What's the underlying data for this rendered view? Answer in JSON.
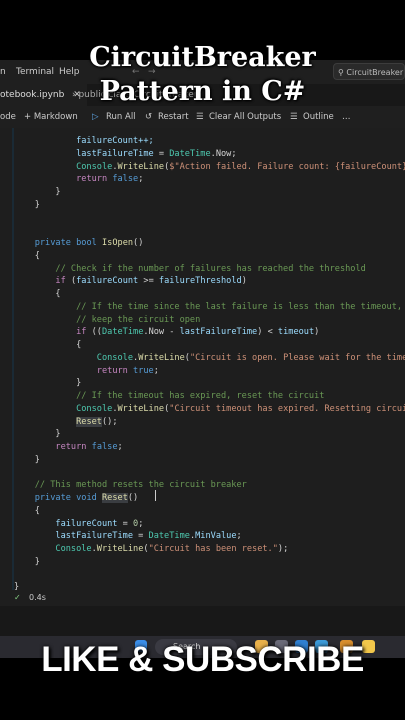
{
  "overlay": {
    "title_line1": "CircuitBreaker",
    "title_line2": "Pattern in C#",
    "cta": "LIKE & SUBSCRIBE"
  },
  "menubar": {
    "items": [
      "n",
      "Terminal",
      "Help"
    ],
    "search": "CircuitBreaker"
  },
  "tabbar": {
    "tab_label": "otebook.ipynb",
    "breadcrumb": "› public class CircuitBreaker"
  },
  "toolbar": {
    "items": [
      "ode",
      "+ Markdown",
      "Run All",
      "Restart",
      "Clear All Outputs",
      "Outline",
      "…"
    ]
  },
  "editor": {
    "lines": [
      [
        {
          "t": "            failureCount++;",
          "c": "var"
        }
      ],
      [
        {
          "t": "            lastFailureTime",
          "c": "var"
        },
        {
          "t": " = ",
          "c": "op"
        },
        {
          "t": "DateTime",
          "c": "ty"
        },
        {
          "t": ".Now;",
          "c": "op"
        }
      ],
      [
        {
          "t": "            Console",
          "c": "ty"
        },
        {
          "t": ".",
          "c": "op"
        },
        {
          "t": "WriteLine",
          "c": "fn"
        },
        {
          "t": "(",
          "c": "op"
        },
        {
          "t": "$\"Action failed. Failure count: {failureCount}\");",
          "c": "str"
        }
      ],
      [
        {
          "t": "            ",
          "c": "op"
        },
        {
          "t": "return",
          "c": "ctl"
        },
        {
          "t": " ",
          "c": "op"
        },
        {
          "t": "false",
          "c": "kw"
        },
        {
          "t": ";",
          "c": "op"
        }
      ],
      [
        {
          "t": "        }",
          "c": "op"
        }
      ],
      [
        {
          "t": "    }",
          "c": "op"
        }
      ],
      [
        {
          "t": "",
          "c": "op"
        }
      ],
      [
        {
          "t": "",
          "c": "op"
        }
      ],
      [
        {
          "t": "    ",
          "c": "op"
        },
        {
          "t": "private",
          "c": "kw"
        },
        {
          "t": " ",
          "c": "op"
        },
        {
          "t": "bool",
          "c": "kw"
        },
        {
          "t": " ",
          "c": "op"
        },
        {
          "t": "IsOpen",
          "c": "fn"
        },
        {
          "t": "()",
          "c": "op"
        }
      ],
      [
        {
          "t": "    {",
          "c": "op"
        }
      ],
      [
        {
          "t": "        // Check if the number of failures has reached the threshold",
          "c": "cm"
        }
      ],
      [
        {
          "t": "        ",
          "c": "op"
        },
        {
          "t": "if",
          "c": "ctl"
        },
        {
          "t": " (",
          "c": "op"
        },
        {
          "t": "failureCount",
          "c": "var"
        },
        {
          "t": " >= ",
          "c": "op"
        },
        {
          "t": "failureThreshold",
          "c": "var"
        },
        {
          "t": ")",
          "c": "op"
        }
      ],
      [
        {
          "t": "        {",
          "c": "op"
        }
      ],
      [
        {
          "t": "            // If the time since the last failure is less than the timeout,",
          "c": "cm"
        }
      ],
      [
        {
          "t": "            // keep the circuit open",
          "c": "cm"
        }
      ],
      [
        {
          "t": "            ",
          "c": "op"
        },
        {
          "t": "if",
          "c": "ctl"
        },
        {
          "t": " ((",
          "c": "op"
        },
        {
          "t": "DateTime",
          "c": "ty"
        },
        {
          "t": ".Now - ",
          "c": "op"
        },
        {
          "t": "lastFailureTime",
          "c": "var"
        },
        {
          "t": ") < ",
          "c": "op"
        },
        {
          "t": "timeout",
          "c": "var"
        },
        {
          "t": ")",
          "c": "op"
        }
      ],
      [
        {
          "t": "            {",
          "c": "op"
        }
      ],
      [
        {
          "t": "                Console",
          "c": "ty"
        },
        {
          "t": ".",
          "c": "op"
        },
        {
          "t": "WriteLine",
          "c": "fn"
        },
        {
          "t": "(",
          "c": "op"
        },
        {
          "t": "\"Circuit is open. Please wait for the timeout.\");",
          "c": "str"
        }
      ],
      [
        {
          "t": "                ",
          "c": "op"
        },
        {
          "t": "return",
          "c": "ctl"
        },
        {
          "t": " ",
          "c": "op"
        },
        {
          "t": "true",
          "c": "kw"
        },
        {
          "t": ";",
          "c": "op"
        }
      ],
      [
        {
          "t": "            }",
          "c": "op"
        }
      ],
      [
        {
          "t": "            // If the timeout has expired, reset the circuit",
          "c": "cm"
        }
      ],
      [
        {
          "t": "            Console",
          "c": "ty"
        },
        {
          "t": ".",
          "c": "op"
        },
        {
          "t": "WriteLine",
          "c": "fn"
        },
        {
          "t": "(",
          "c": "op"
        },
        {
          "t": "\"Circuit timeout has expired. Resetting circuit.\");",
          "c": "str"
        }
      ],
      [
        {
          "t": "            ",
          "c": "op"
        },
        {
          "t": "Reset",
          "c": "fn",
          "h": 1
        },
        {
          "t": "();",
          "c": "op"
        }
      ],
      [
        {
          "t": "        }",
          "c": "op"
        }
      ],
      [
        {
          "t": "        ",
          "c": "op"
        },
        {
          "t": "return",
          "c": "ctl"
        },
        {
          "t": " ",
          "c": "op"
        },
        {
          "t": "false",
          "c": "kw"
        },
        {
          "t": ";",
          "c": "op"
        }
      ],
      [
        {
          "t": "    }",
          "c": "op"
        }
      ],
      [
        {
          "t": "",
          "c": "op"
        }
      ],
      [
        {
          "t": "    // This method resets the circuit breaker",
          "c": "cm"
        }
      ],
      [
        {
          "t": "    ",
          "c": "op"
        },
        {
          "t": "private",
          "c": "kw"
        },
        {
          "t": " ",
          "c": "op"
        },
        {
          "t": "void",
          "c": "kw"
        },
        {
          "t": " ",
          "c": "op"
        },
        {
          "t": "Reset",
          "c": "fn",
          "h": 1
        },
        {
          "t": "()",
          "c": "op"
        }
      ],
      [
        {
          "t": "    {",
          "c": "op"
        }
      ],
      [
        {
          "t": "        failureCount",
          "c": "var"
        },
        {
          "t": " = ",
          "c": "op"
        },
        {
          "t": "0",
          "c": "num"
        },
        {
          "t": ";",
          "c": "op"
        }
      ],
      [
        {
          "t": "        lastFailureTime",
          "c": "var"
        },
        {
          "t": " = ",
          "c": "op"
        },
        {
          "t": "DateTime",
          "c": "ty"
        },
        {
          "t": ".",
          "c": "op"
        },
        {
          "t": "MinValue",
          "c": "var"
        },
        {
          "t": ";",
          "c": "op"
        }
      ],
      [
        {
          "t": "        Console",
          "c": "ty"
        },
        {
          "t": ".",
          "c": "op"
        },
        {
          "t": "WriteLine",
          "c": "fn"
        },
        {
          "t": "(",
          "c": "op"
        },
        {
          "t": "\"Circuit has been reset.\"",
          "c": "str"
        },
        {
          "t": ");",
          "c": "op"
        }
      ],
      [
        {
          "t": "    }",
          "c": "op"
        }
      ],
      [
        {
          "t": "",
          "c": "op"
        }
      ],
      [
        {
          "t": "}",
          "c": "op"
        }
      ]
    ]
  },
  "status": {
    "check": "✓",
    "time": "0.4s"
  },
  "taskbar": {
    "search": "Search"
  }
}
